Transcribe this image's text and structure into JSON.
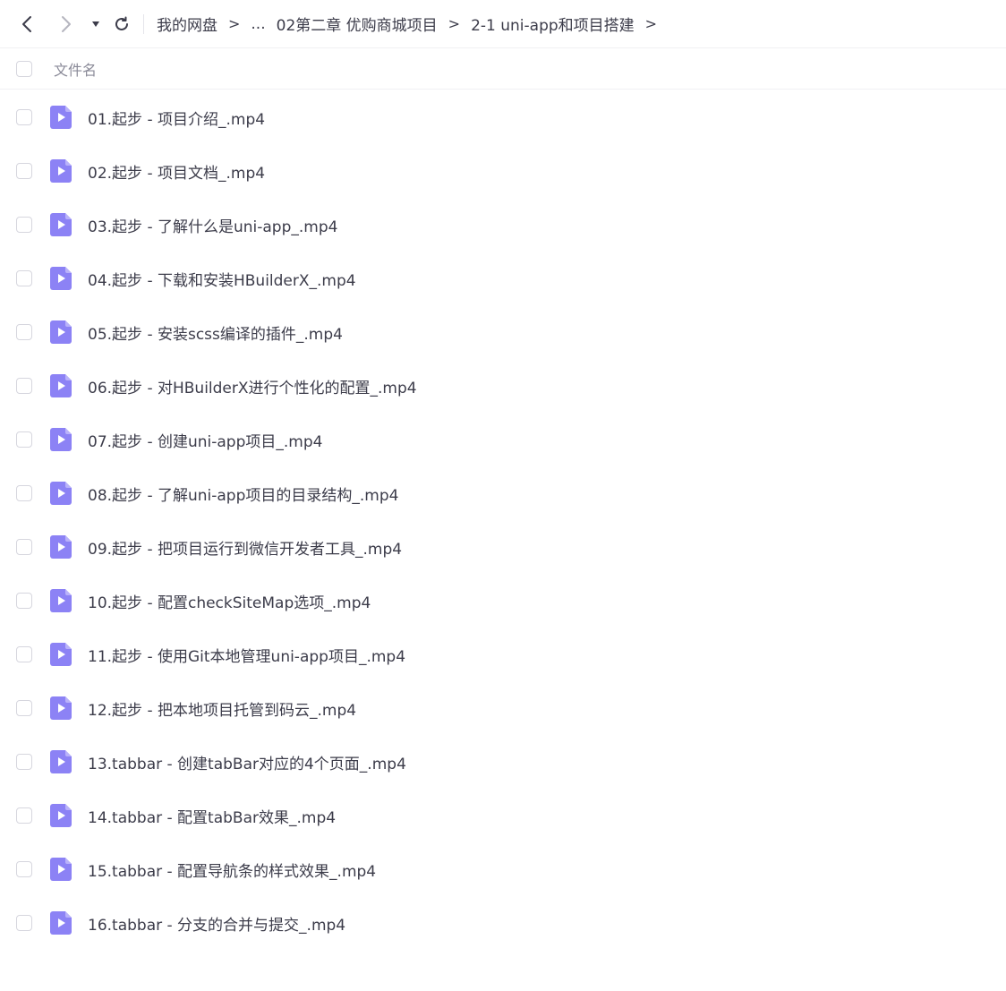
{
  "breadcrumb": {
    "items": [
      "我的网盘",
      "...",
      "02第二章 优购商城项目",
      "2-1 uni-app和项目搭建"
    ],
    "separator": ">"
  },
  "icons": {
    "back": "chevron-left-icon",
    "forward": "chevron-right-icon",
    "history": "caret-down-icon",
    "refresh": "refresh-icon",
    "video": "video-file-icon"
  },
  "colors": {
    "video_icon": "#8c82f5",
    "video_icon_fold": "#b9b2fa"
  },
  "list_header": {
    "column_name": "文件名"
  },
  "files": [
    {
      "name": "01.起步 - 项目介绍_.mp4"
    },
    {
      "name": "02.起步 - 项目文档_.mp4"
    },
    {
      "name": "03.起步 - 了解什么是uni-app_.mp4"
    },
    {
      "name": "04.起步 - 下载和安装HBuilderX_.mp4"
    },
    {
      "name": "05.起步 - 安装scss编译的插件_.mp4"
    },
    {
      "name": "06.起步 - 对HBuilderX进行个性化的配置_.mp4"
    },
    {
      "name": "07.起步 - 创建uni-app项目_.mp4"
    },
    {
      "name": "08.起步 - 了解uni-app项目的目录结构_.mp4"
    },
    {
      "name": "09.起步 - 把项目运行到微信开发者工具_.mp4"
    },
    {
      "name": "10.起步 - 配置checkSiteMap选项_.mp4"
    },
    {
      "name": "11.起步 - 使用Git本地管理uni-app项目_.mp4"
    },
    {
      "name": "12.起步 - 把本地项目托管到码云_.mp4"
    },
    {
      "name": "13.tabbar - 创建tabBar对应的4个页面_.mp4"
    },
    {
      "name": "14.tabbar - 配置tabBar效果_.mp4"
    },
    {
      "name": "15.tabbar - 配置导航条的样式效果_.mp4"
    },
    {
      "name": "16.tabbar - 分支的合并与提交_.mp4"
    }
  ]
}
